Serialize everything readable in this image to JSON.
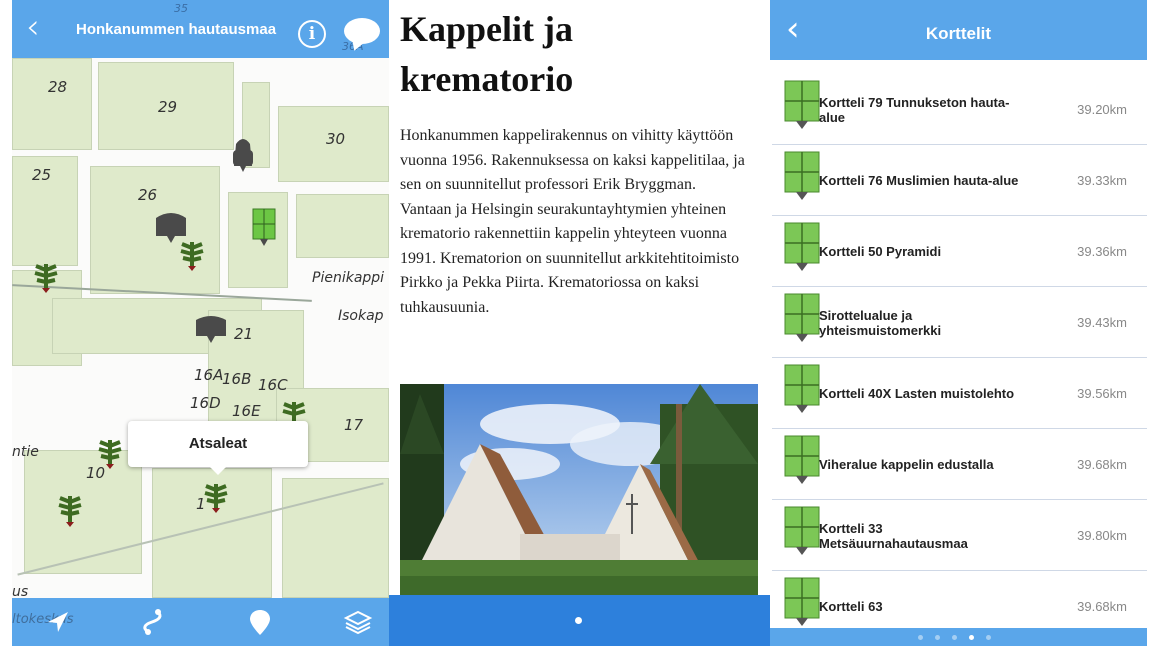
{
  "map_screen": {
    "title": "Honkanummen hautausmaa",
    "back_icon": "chevron-left-icon",
    "info_label": "i",
    "header_faded_numbers": [
      "35",
      "36A"
    ],
    "plot_numbers": [
      "28",
      "29",
      "30",
      "25",
      "26",
      "21",
      "16A",
      "16B",
      "16C",
      "16D",
      "16E",
      "17",
      "10",
      "1"
    ],
    "street_labels": [
      "Pienikappi",
      "Isokap",
      "ntie",
      "us"
    ],
    "popup_label": "Atsaleat",
    "toolbar_faded_text": "ltokeskus",
    "toolbar_icons": [
      "location-arrow-icon",
      "route-icon",
      "map-pin-icon",
      "layers-icon"
    ],
    "colors": {
      "header": "#5aa6ea",
      "block": "#dfeacb",
      "marker_grey": "#4a4a4a",
      "marker_green": "#6cc644"
    }
  },
  "article_screen": {
    "title_line1": "Kappelit ja",
    "title_line2": "krematorio",
    "body": "Honkanummen kappelirakennus on vihitty käyttöön vuonna 1956. Rakennuksessa on kaksi kappelitilaa, ja sen on suunnitellut professori Erik Bryggman. Vantaan ja Helsingin seurakuntayhtymien yhteinen krematorio rakennettiin kappelin yhteyteen vuonna 1991. Krematorion on suunnitellut arkkitehtitoimisto Pirkko ja Pekka Piirta. Krematoriossa on kaksi tuhkausuunia.",
    "page_indicator": {
      "count": 1,
      "active": 0
    },
    "colors": {
      "footer": "#2d80dc"
    }
  },
  "list_screen": {
    "title": "Korttelit",
    "back_icon": "chevron-left-icon",
    "items": [
      {
        "name": "Kortteli 79 Tunnukseton hauta-alue",
        "distance": "39.20km"
      },
      {
        "name": "Kortteli 76 Muslimien hauta-alue",
        "distance": "39.33km"
      },
      {
        "name": "Kortteli 50 Pyramidi",
        "distance": "39.36km"
      },
      {
        "name": "Sirottelualue ja yhteismuistomerkki",
        "distance": "39.43km"
      },
      {
        "name": "Kortteli 40X Lasten muistolehto",
        "distance": "39.56km"
      },
      {
        "name": "Viheralue kappelin edustalla",
        "distance": "39.68km"
      },
      {
        "name": "Kortteli 33 Metsäuurnahautausmaa",
        "distance": "39.80km"
      },
      {
        "name": "Kortteli 63",
        "distance": "39.68km"
      }
    ],
    "page_indicator": {
      "count": 5,
      "active": 3
    },
    "colors": {
      "header": "#5aa6ea",
      "icon_green": "#7cc756"
    }
  }
}
